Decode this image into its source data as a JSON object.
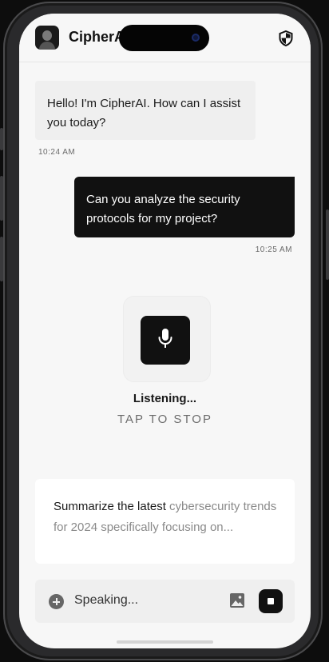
{
  "header": {
    "app_title": "CipherAI",
    "avatar": "user-avatar",
    "security_icon": "shield-icon"
  },
  "messages": [
    {
      "sender": "ai",
      "text": "Hello! I'm CipherAI. How can I assist you today?",
      "time": "10:24 AM"
    },
    {
      "sender": "user",
      "text": "Can you analyze the security protocols for my project?",
      "time": "10:25 AM"
    }
  ],
  "voice": {
    "icon": "microphone-icon",
    "status": "Listening...",
    "hint": "TAP TO STOP"
  },
  "transcript": {
    "confirmed": "Summarize the latest",
    "pending": " cybersecurity trends for 2024 specifically focusing on..."
  },
  "input": {
    "placeholder": "Speaking...",
    "add_icon": "plus-circle-icon",
    "image_icon": "image-icon",
    "stop_icon": "stop-icon"
  },
  "colors": {
    "background": "#f7f7f7",
    "accent": "#111111",
    "user_bubble": "#111111",
    "ai_bubble": "#efefef"
  }
}
